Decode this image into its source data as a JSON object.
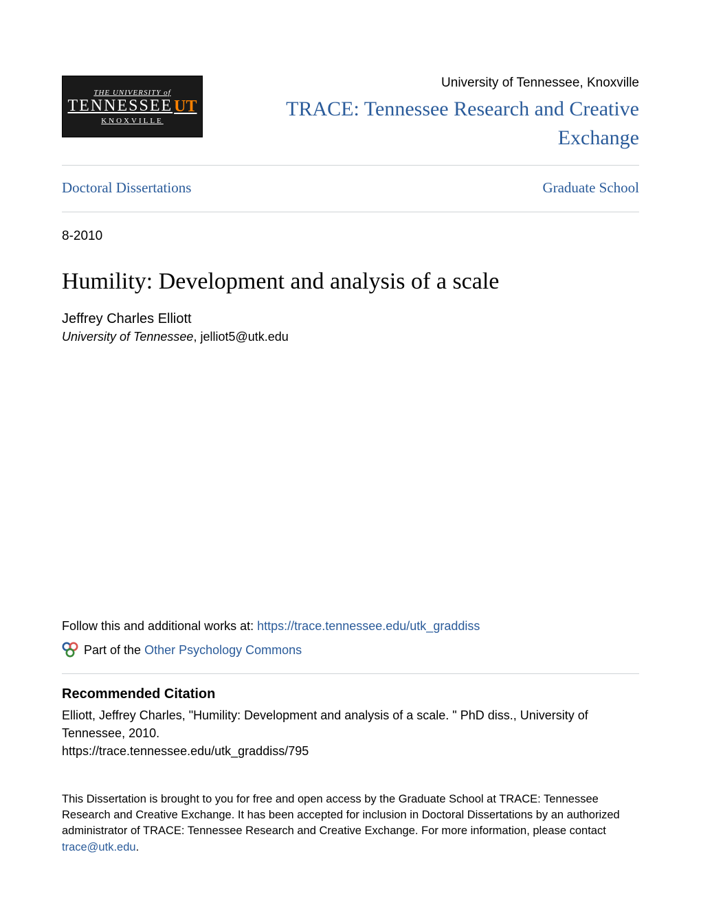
{
  "header": {
    "logo": {
      "line1": "THE UNIVERSITY of",
      "line2": "TENNESSEE",
      "t_mark": "UT",
      "line3": "KNOXVILLE"
    },
    "university": "University of Tennessee, Knoxville",
    "site_title": "TRACE: Tennessee Research and Creative Exchange"
  },
  "breadcrumb": {
    "left_label": "Doctoral Dissertations",
    "right_label": "Graduate School"
  },
  "date": "8-2010",
  "title": "Humility: Development and analysis of a scale",
  "author": {
    "name": "Jeffrey Charles Elliott",
    "institution": "University of Tennessee",
    "email": "jelliot5@utk.edu"
  },
  "follow": {
    "prefix": "Follow this and additional works at: ",
    "url_text": "https://trace.tennessee.edu/utk_graddiss"
  },
  "partof": {
    "prefix": "Part of the ",
    "link_text": "Other Psychology Commons"
  },
  "citation": {
    "heading": "Recommended Citation",
    "line1": "Elliott, Jeffrey Charles, \"Humility: Development and analysis of a scale. \" PhD diss., University of Tennessee, 2010.",
    "line2": "https://trace.tennessee.edu/utk_graddiss/795"
  },
  "disclaimer": {
    "text": "This Dissertation is brought to you for free and open access by the Graduate School at TRACE: Tennessee Research and Creative Exchange. It has been accepted for inclusion in Doctoral Dissertations by an authorized administrator of TRACE: Tennessee Research and Creative Exchange. For more information, please contact ",
    "email_text": "trace@utk.edu",
    "period": "."
  }
}
